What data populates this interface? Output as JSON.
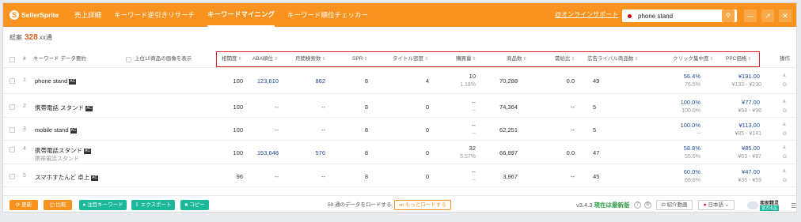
{
  "header": {
    "logo": "SellerSprite",
    "nav": [
      "売上詳細",
      "キーワード逆引きリサーチ",
      "キーワードマイニング",
      "キーワード順位チェッカー"
    ],
    "support": "@オンラインサポート",
    "search_value": "phone stand",
    "search_icon": "search-icon",
    "window_controls": [
      "minimize-icon",
      "expand-icon",
      "close-icon"
    ],
    "accent_color": "#f7931e"
  },
  "summary": {
    "label": "総案",
    "count": "328",
    "unit": "xx通"
  },
  "columns": {
    "keyword": "キーワード",
    "keyword_link": "データ要約",
    "show_images": "上位10商品の画像を表示",
    "related": "相関度",
    "aba": "ABA順位",
    "monthly": "月間検索数",
    "spr": "SPR",
    "title_density": "タイトル密度",
    "purchase": "購買量",
    "products": "商品数",
    "supply_demand": "需給比",
    "ad_competitors": "広告ライバル商品数",
    "click_conc": "クリック集中度",
    "ppc": "PPC価格",
    "ops": "操作"
  },
  "rows": [
    {
      "idx": "1",
      "keyword": "phone stand",
      "badge": "AC",
      "sub": "",
      "related": "100",
      "aba": "123,610",
      "monthly": "862",
      "spr": "8",
      "title_density": "4",
      "purchase": "10",
      "purchase_sub": "1.18%",
      "products": "70,288",
      "supply_demand": "0.0",
      "ad_competitors": "49",
      "click_conc": "56.4%",
      "click_conc_sub": "76.5%",
      "ppc": "¥191.00",
      "ppc_sub": "¥133 - ¥230",
      "ops": [
        "a",
        "G"
      ]
    },
    {
      "idx": "2",
      "keyword": "携帯電話 スタンド",
      "badge": "AC",
      "sub": "",
      "related": "100",
      "aba": "--",
      "monthly": "--",
      "spr": "8",
      "title_density": "0",
      "purchase": "--",
      "purchase_sub": "--",
      "products": "74,364",
      "supply_demand": "--",
      "ad_competitors": "5",
      "click_conc": "100.0%",
      "click_conc_sub": "100.0%",
      "ppc": "¥77.00",
      "ppc_sub": "¥58 - ¥96",
      "ops": [
        "a",
        "G"
      ]
    },
    {
      "idx": "3",
      "keyword": "mobile stand",
      "badge": "AC",
      "sub": "",
      "related": "100",
      "aba": "--",
      "monthly": "--",
      "spr": "8",
      "title_density": "0",
      "purchase": "--",
      "purchase_sub": "--",
      "products": "62,251",
      "supply_demand": "--",
      "ad_competitors": "5",
      "click_conc": "100.0%",
      "click_conc_sub": "--",
      "ppc": "¥113.00",
      "ppc_sub": "¥85 - ¥141",
      "ops": [
        "a",
        "G"
      ]
    },
    {
      "idx": "4",
      "keyword": "携帯電話スタンド",
      "badge": "AC",
      "sub": "携帯電話スタンド",
      "related": "100",
      "aba": "153,648",
      "monthly": "576",
      "spr": "8",
      "title_density": "0",
      "purchase": "32",
      "purchase_sub": "5.57%",
      "products": "66,897",
      "supply_demand": "0.0",
      "ad_competitors": "47",
      "click_conc": "58.8%",
      "click_conc_sub": "55.6%",
      "ppc": "¥85.00",
      "ppc_sub": "¥63 - ¥87",
      "ops": [
        "a",
        "G"
      ]
    },
    {
      "idx": "5",
      "keyword": "スマホすたんど 卓上",
      "badge": "AC",
      "sub": "",
      "related": "96",
      "aba": "--",
      "monthly": "--",
      "spr": "8",
      "title_density": "0",
      "purchase": "--",
      "purchase_sub": "--",
      "products": "3,967",
      "supply_demand": "--",
      "ad_competitors": "45",
      "click_conc": "60.0%",
      "click_conc_sub": "66.8%",
      "ppc": "¥47.00",
      "ppc_sub": "¥36 - ¥59",
      "ops": [
        "a",
        "G"
      ]
    }
  ],
  "footer": {
    "refresh": "更新",
    "compare": "比較",
    "watch": "注目キーワード",
    "export": "エクスポート",
    "copy": "コピー",
    "load_text": "50 通のデータをロードする",
    "load_more": "もっとロードする",
    "version": "v3.4.3",
    "version_status": "現在は最新版",
    "intro_video": "紹介動画",
    "language": "日本語",
    "brand_name": "卖家精灵",
    "brand_tag": "官方出品"
  }
}
